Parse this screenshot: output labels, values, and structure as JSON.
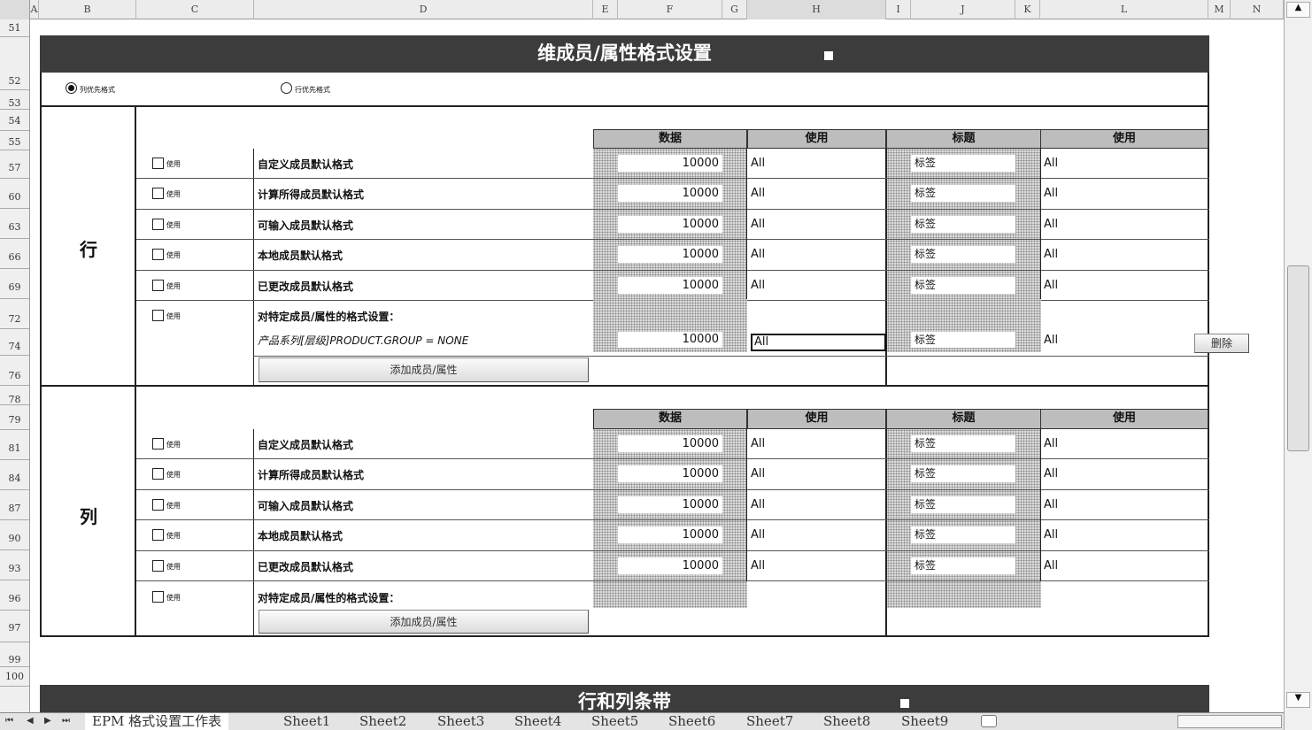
{
  "columns": [
    "A",
    "B",
    "C",
    "D",
    "E",
    "F",
    "G",
    "H",
    "I",
    "J",
    "K",
    "L",
    "M",
    "N"
  ],
  "rows": [
    "51",
    "52",
    "53",
    "54",
    "55",
    "57",
    "60",
    "63",
    "66",
    "69",
    "72",
    "74",
    "76",
    "78",
    "79",
    "81",
    "84",
    "87",
    "90",
    "93",
    "96",
    "97",
    "99",
    "100"
  ],
  "panel": {
    "title": "维成员/属性格式设置",
    "radio_column": "列优先格式",
    "radio_row": "行优先格式"
  },
  "sections": {
    "row": {
      "label": "行",
      "headers": {
        "data": "数据",
        "use1": "使用",
        "header": "标题",
        "use2": "使用"
      },
      "items": [
        {
          "checkbox": "使用",
          "label": "自定义成员默认格式",
          "value": "10000",
          "use": "All",
          "tag": "标签",
          "use2": "All"
        },
        {
          "checkbox": "使用",
          "label": "计算所得成员默认格式",
          "value": "10000",
          "use": "All",
          "tag": "标签",
          "use2": "All"
        },
        {
          "checkbox": "使用",
          "label": "可输入成员默认格式",
          "value": "10000",
          "use": "All",
          "tag": "标签",
          "use2": "All"
        },
        {
          "checkbox": "使用",
          "label": "本地成员默认格式",
          "value": "10000",
          "use": "All",
          "tag": "标签",
          "use2": "All"
        },
        {
          "checkbox": "使用",
          "label": "已更改成员默认格式",
          "value": "10000",
          "use": "All",
          "tag": "标签",
          "use2": "All"
        }
      ],
      "specific": {
        "checkbox": "使用",
        "label": "对特定成员/属性的格式设置：",
        "sub_label": "产品系列[层级]PRODUCT.GROUP = NONE",
        "value": "10000",
        "use": "All",
        "tag": "标签",
        "use2": "All",
        "delete": "删除"
      },
      "add_button": "添加成员/属性"
    },
    "col": {
      "label": "列",
      "headers": {
        "data": "数据",
        "use1": "使用",
        "header": "标题",
        "use2": "使用"
      },
      "items": [
        {
          "checkbox": "使用",
          "label": "自定义成员默认格式",
          "value": "10000",
          "use": "All",
          "tag": "标签",
          "use2": "All"
        },
        {
          "checkbox": "使用",
          "label": "计算所得成员默认格式",
          "value": "10000",
          "use": "All",
          "tag": "标签",
          "use2": "All"
        },
        {
          "checkbox": "使用",
          "label": "可输入成员默认格式",
          "value": "10000",
          "use": "All",
          "tag": "标签",
          "use2": "All"
        },
        {
          "checkbox": "使用",
          "label": "本地成员默认格式",
          "value": "10000",
          "use": "All",
          "tag": "标签",
          "use2": "All"
        },
        {
          "checkbox": "使用",
          "label": "已更改成员默认格式",
          "value": "10000",
          "use": "All",
          "tag": "标签",
          "use2": "All"
        }
      ],
      "specific": {
        "checkbox": "使用",
        "label": "对特定成员/属性的格式设置："
      },
      "add_button": "添加成员/属性"
    }
  },
  "panel2": {
    "title": "行和列条带"
  },
  "tabs": [
    "EPM 格式设置工作表",
    "Sheet1",
    "Sheet2",
    "Sheet3",
    "Sheet4",
    "Sheet5",
    "Sheet6",
    "Sheet7",
    "Sheet8",
    "Sheet9"
  ],
  "nav": {
    "first": "⏮",
    "prev": "◀",
    "next": "▶",
    "last": "⏭"
  }
}
